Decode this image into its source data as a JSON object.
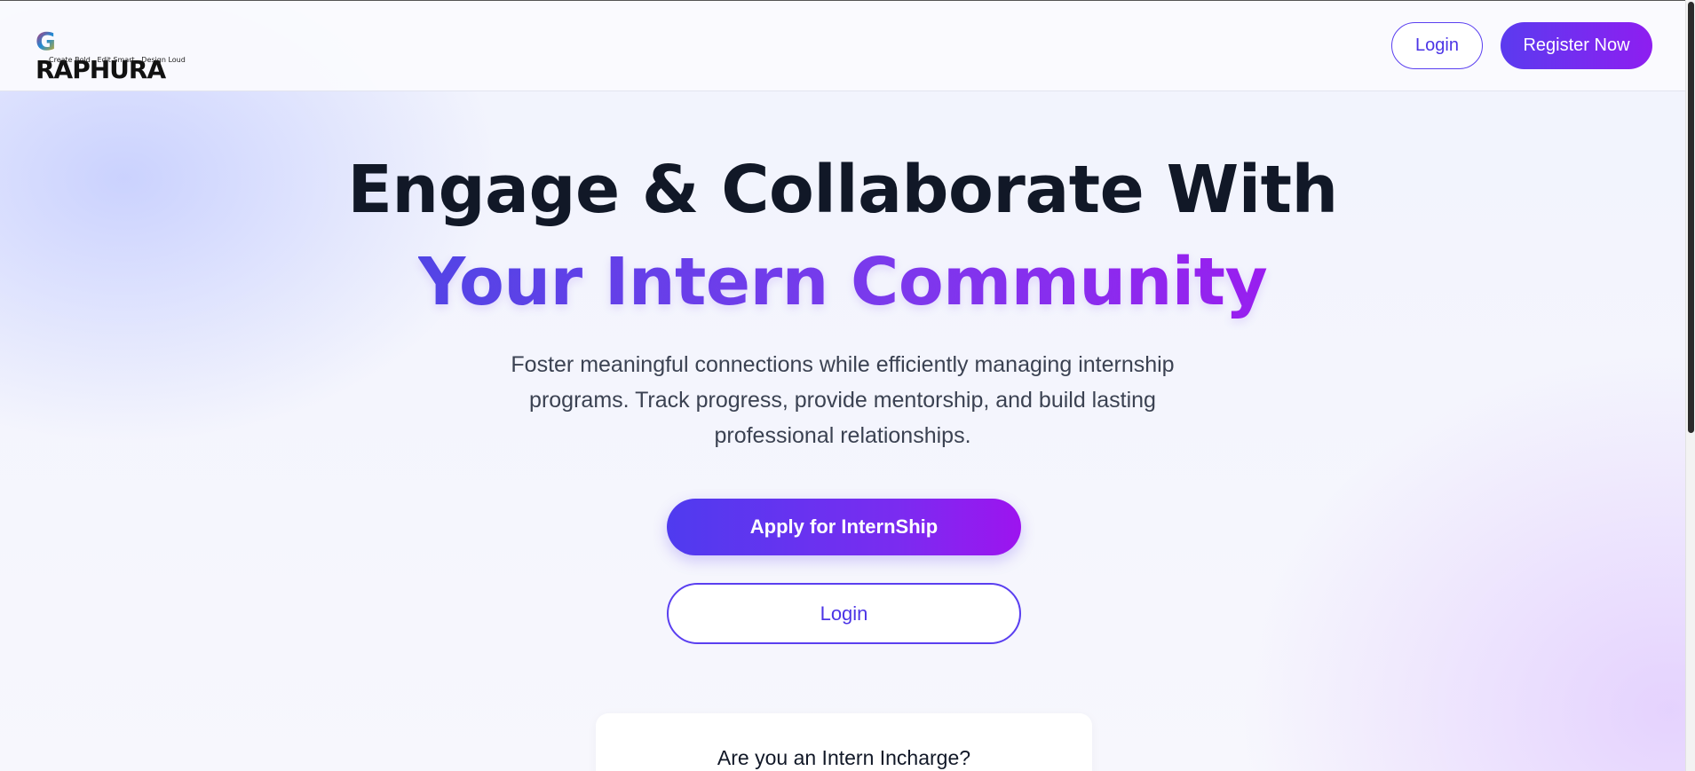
{
  "header": {
    "logo_text": "GRAPHURA",
    "logo_tagline": "Create Bold . Edit Smart . Design Loud",
    "login_label": "Login",
    "register_label": "Register Now"
  },
  "hero": {
    "title_line1": "Engage & Collaborate With",
    "title_line2": "Your Intern Community",
    "description": "Foster meaningful connections while efficiently managing internship programs. Track progress, provide mentorship, and build lasting professional relationships.",
    "apply_label": "Apply for InternShip",
    "login_label": "Login"
  },
  "incharge": {
    "question": "Are you an Intern Incharge?"
  },
  "colors": {
    "accent_start": "#5b3bef",
    "accent_end": "#9d14ef",
    "heading": "#111827",
    "body_text": "#3b4252"
  }
}
